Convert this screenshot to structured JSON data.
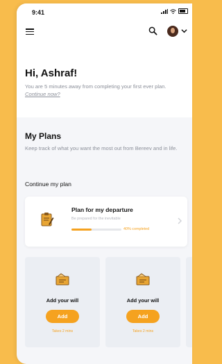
{
  "status": {
    "time": "9:41"
  },
  "header": {
    "greeting": "Hi, Ashraf!",
    "subtitle": "You are 5 minutes away from completing your first ever plan.",
    "continue_link": "Continue now?"
  },
  "plans": {
    "title": "My Plans",
    "description": "Keep track of what you want the most out from Bereev and in life.",
    "continue_label": "Continue my plan"
  },
  "current_plan": {
    "name": "Plan for my departure",
    "subtitle": "Be prepared for the inevitable",
    "progress_percent": 40,
    "progress_label": "40% completed"
  },
  "tasks": [
    {
      "title": "Add your will",
      "button": "Add",
      "time": "Takes 2 mins"
    },
    {
      "title": "Add your will",
      "button": "Add",
      "time": "Takes 2 mins"
    }
  ],
  "colors": {
    "accent": "#f5a21f",
    "background": "#f8bc4c"
  },
  "icons": [
    "menu-icon",
    "search-icon",
    "avatar",
    "chevron-down-icon",
    "clipboard-icon",
    "folder-icon",
    "chevron-right-icon"
  ]
}
